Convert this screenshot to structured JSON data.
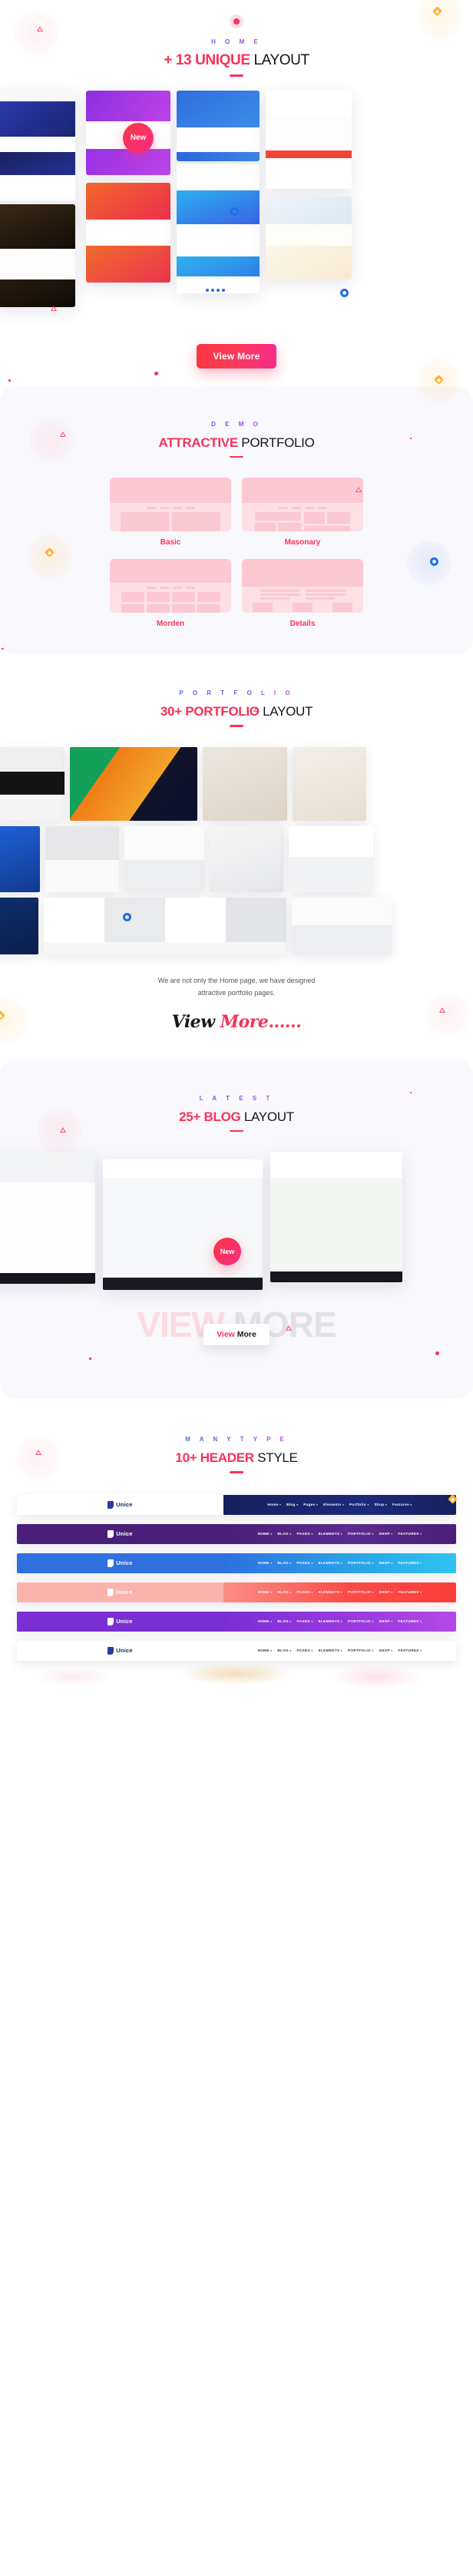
{
  "hero": {
    "eyebrow": "H O M E",
    "title_strong": "+ 13 UNIQUE",
    "title_rest": " LAYOUT",
    "badge": "New",
    "view_more": "View More"
  },
  "demo": {
    "eyebrow": "D E M O",
    "title_strong": "ATTRACTIVE",
    "title_rest": " PORTFOLIO",
    "cards": [
      {
        "label": "Basic",
        "style": "basic"
      },
      {
        "label": "Masonary",
        "style": "masonary"
      },
      {
        "label": "Morden",
        "style": "morden"
      },
      {
        "label": "Details",
        "style": "details"
      }
    ]
  },
  "portfolio": {
    "eyebrow": "P O R T F O L I O",
    "title_strong": "30+ PORTFOLIO",
    "title_rest": " LAYOUT",
    "caption_line1": "We are not only the Home page, we have designed",
    "caption_line2": "attractive portfolio pages.",
    "script_black": "View ",
    "script_red": "More......"
  },
  "blog": {
    "eyebrow": "L A T E S T",
    "title_strong": "25+ BLOG",
    "title_rest": " LAYOUT",
    "badge": "New",
    "ghost_pink": "VIEW",
    "ghost_gray": " MORE",
    "btn_red": "View",
    "btn_dark": " More"
  },
  "headers": {
    "eyebrow": "M A N Y   T Y P E",
    "title_strong": "10+ HEADER",
    "title_rest": " STYLE",
    "nav": [
      "Home",
      "Blog",
      "Pages",
      "Elements",
      "Portfolio",
      "Shop",
      "Features"
    ],
    "bars": [
      {
        "brand": "Unice",
        "brand_bg": "#ffffff",
        "brand_color": "#17205c",
        "nav_bg": "linear-gradient(90deg,#16205e 0%, #1b2a7a 60%, #16205e 100%)",
        "nav_color": "#ffffff"
      },
      {
        "brand": "Unice",
        "brand_bg": "#4a1f7a",
        "brand_color": "#ffffff",
        "nav_bg": "linear-gradient(90deg,#4a1f7a 0%, #5b2a8f 55%, #4a1f7a 100%)",
        "nav_color": "#ffffff"
      },
      {
        "brand": "Unice",
        "brand_bg": "#2f6fe0",
        "brand_color": "#ffffff",
        "nav_bg": "linear-gradient(90deg,#2f6fe0 0%, #2aa6e8 60%, #2ec4ee 100%)",
        "nav_color": "#ffffff"
      },
      {
        "brand": "Unice",
        "brand_bg": "#fbb3ae",
        "brand_color": "#ffffff",
        "nav_bg": "linear-gradient(90deg,#fb8e86 0%, #fb4a46 55%, #fb3f3b 100%)",
        "nav_color": "#ffffff"
      },
      {
        "brand": "Unice",
        "brand_bg": "#7a2fd4",
        "brand_color": "#ffffff",
        "nav_bg": "linear-gradient(90deg,#7a2fd4 0%, #9b3ae0 60%, #b44ae8 100%)",
        "nav_color": "#ffffff"
      },
      {
        "brand": "Unice",
        "brand_bg": "#ffffff",
        "brand_color": "#17205c",
        "nav_bg": "linear-gradient(90deg,#ffffff 0%, #ffffff 100%)",
        "nav_color": "#3a3a4a"
      }
    ]
  },
  "colors": {
    "accent_red": "#f8325a",
    "accent_pink": "#f62d8b",
    "eyebrow_gradient_start": "#4b6ee8",
    "eyebrow_gradient_end": "#c44fe0",
    "panel_bg": "#f9f8fc",
    "card_pink": "#fbd3da",
    "diamond_yellow": "#ffb02e",
    "ring_blue": "#1f6fe5"
  }
}
